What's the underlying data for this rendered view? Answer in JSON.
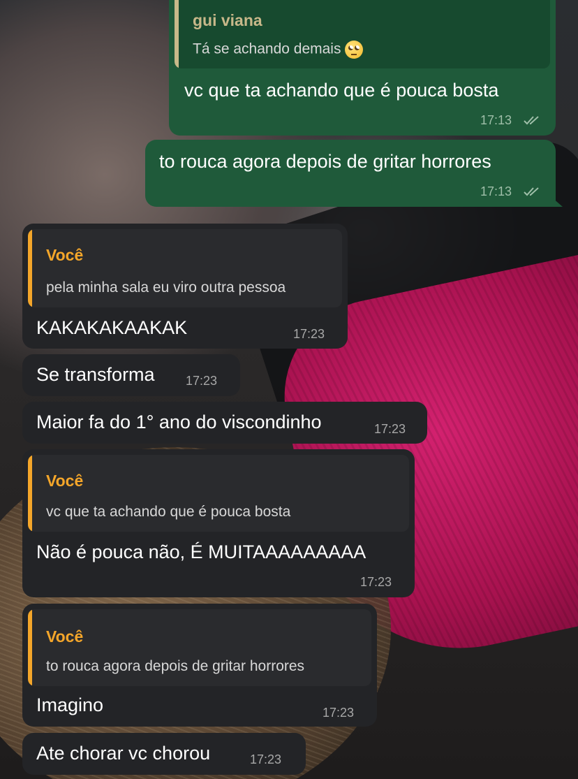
{
  "messages": {
    "m1": {
      "quote_name": "gui viana",
      "quote_text": "Tá se achando demais",
      "text": "vc que ta achando que é pouca bosta",
      "time": "17:13"
    },
    "m2": {
      "text": "to rouca agora depois de gritar horrores",
      "time": "17:13"
    },
    "m3": {
      "quote_name": "Você",
      "quote_text": "pela minha sala eu viro outra pessoa",
      "text": "KAKAKAKAAKAK",
      "time": "17:23"
    },
    "m4": {
      "text": "Se transforma",
      "time": "17:23"
    },
    "m5": {
      "text": "Maior fa do 1° ano do viscondinho",
      "time": "17:23"
    },
    "m6": {
      "quote_name": "Você",
      "quote_text": "vc que ta achando que é pouca bosta",
      "text": "Não é pouca não, É MUITAAAAAAAAA",
      "time": "17:23"
    },
    "m7": {
      "quote_name": "Você",
      "quote_text": "to rouca agora depois de gritar horrores",
      "text": "Imagino",
      "time": "17:23"
    },
    "m8": {
      "text": "Ate chorar vc chorou",
      "time": "17:23"
    }
  },
  "icons": {
    "read_receipt": "double-check-icon",
    "emoji": "eye-roll-emoji-icon"
  },
  "colors": {
    "outgoing_bubble": "#1f5a3a",
    "incoming_bubble": "#232427",
    "quote_accent_in": "#f4a62a",
    "quote_accent_out": "#c9b98a"
  }
}
